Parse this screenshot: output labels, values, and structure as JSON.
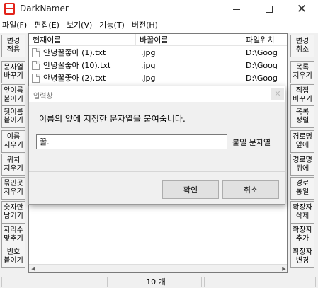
{
  "window": {
    "title": "DarkNamer",
    "icon": "red-app-icon"
  },
  "menu": [
    "파일(F)",
    "편집(E)",
    "보기(V)",
    "기능(T)",
    "버전(H)"
  ],
  "left_buttons": [
    "변경\n적용",
    "문자열\n바꾸기",
    "앞이름\n붙이기",
    "뒷이름\n붙이기",
    "이름\n지우기",
    "위치\n지우기",
    "묶인곳\n지우기",
    "숫자만\n남기기",
    "자리수\n맞추기",
    "번호\n붙이기"
  ],
  "right_buttons": [
    "변경\n취소",
    "목록\n지우기",
    "직접\n바꾸기",
    "목록\n정렬",
    "경로명\n앞에",
    "경로명\n뒤에",
    "경로\n통일",
    "확장자\n삭제",
    "확장자\n추가",
    "확장자\n변경"
  ],
  "list": {
    "columns": [
      "현재이름",
      "바꿀이름",
      "파일위치"
    ],
    "rows": [
      {
        "current": "안녕꿀좋아 (1).txt",
        "new": ".jpg",
        "path": "D:\\Goog"
      },
      {
        "current": "안녕꿀좋아 (10).txt",
        "new": ".jpg",
        "path": "D:\\Goog"
      },
      {
        "current": "안녕꿀좋아 (2).txt",
        "new": ".jpg",
        "path": "D:\\Goog"
      }
    ]
  },
  "status": {
    "count": "10 개"
  },
  "dialog": {
    "title": "입력창",
    "message": "이름의 앞에 지정한 문자열을 붙여줍니다.",
    "input_value": "꿀.",
    "input_suffix": "붙일 문자열",
    "ok_label": "확인",
    "cancel_label": "취소"
  }
}
